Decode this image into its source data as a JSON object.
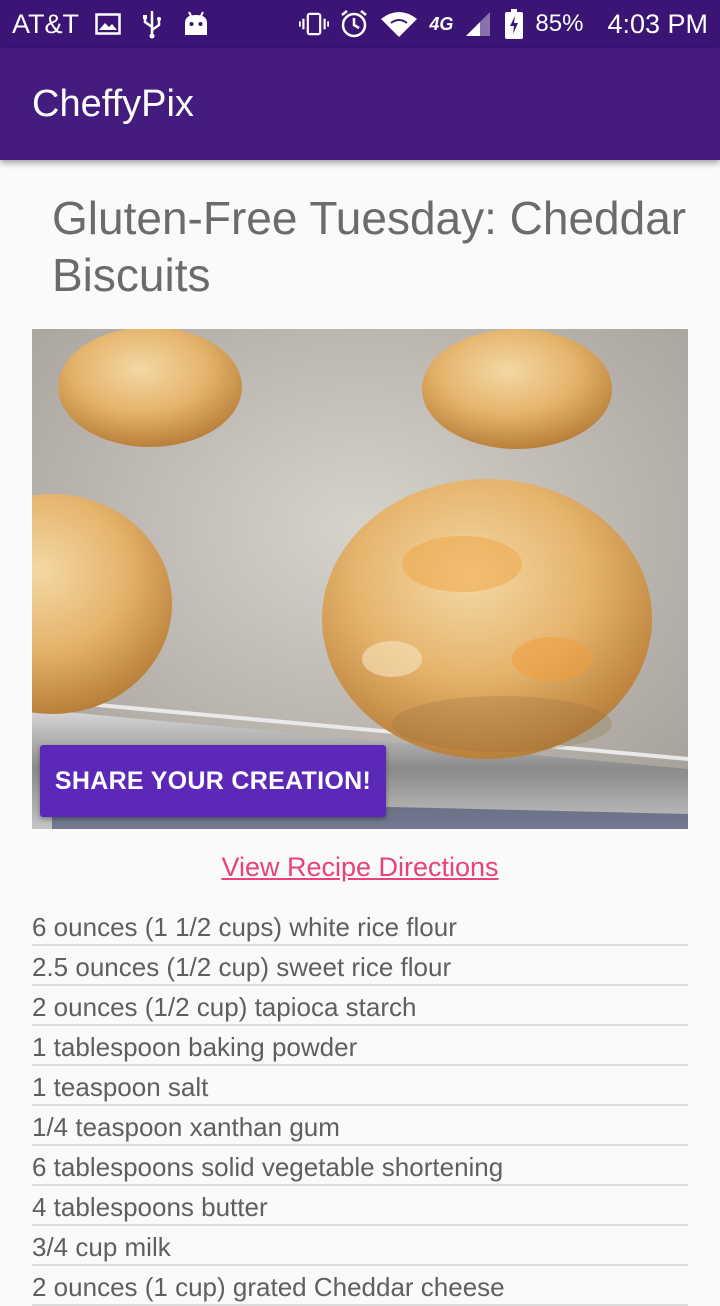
{
  "status_bar": {
    "carrier": "AT&T",
    "network": "4G",
    "battery": "85%",
    "time": "4:03 PM",
    "icons": [
      "image-icon",
      "usb-icon",
      "android-icon",
      "vibrate-icon",
      "alarm-icon",
      "wifi-icon",
      "signal-icon",
      "battery-charging-icon"
    ]
  },
  "app_bar": {
    "title": "CheffyPix"
  },
  "recipe": {
    "title": "Gluten-Free Tuesday: Cheddar Biscuits",
    "share_label": "SHARE YOUR CREATION!",
    "directions_label": "View Recipe Directions",
    "ingredients": [
      "6 ounces (1 1/2 cups) white rice flour",
      "2.5 ounces (1/2 cup) sweet rice flour",
      "2 ounces (1/2 cup) tapioca starch",
      "1 tablespoon baking powder",
      "1 teaspoon salt",
      "1/4 teaspoon xanthan gum",
      "6 tablespoons solid vegetable shortening",
      "4 tablespoons butter",
      "3/4 cup milk",
      "2 ounces (1 cup) grated Cheddar cheese"
    ]
  },
  "colors": {
    "status_bar": "#3a1576",
    "app_bar": "#431c7e",
    "accent_button": "#5b28b8",
    "link": "#e8417e"
  }
}
